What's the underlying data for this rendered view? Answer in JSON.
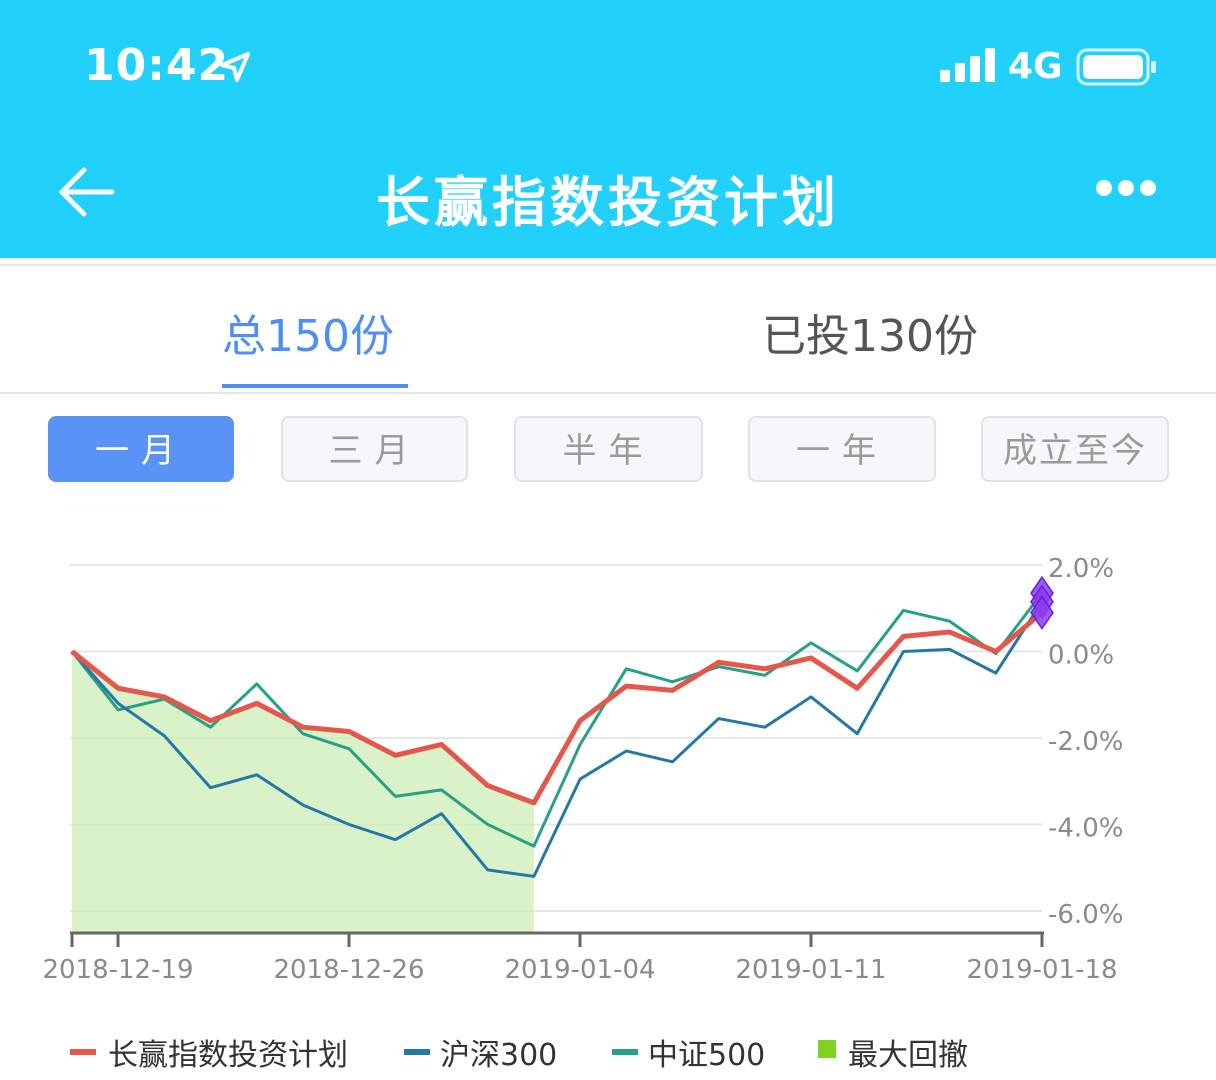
{
  "status_bar": {
    "time": "10:42",
    "network": "4G"
  },
  "nav": {
    "title": "长赢指数投资计划"
  },
  "tabs": [
    {
      "label": "总150份",
      "active": true
    },
    {
      "label": "已投130份",
      "active": false
    }
  ],
  "range_buttons": [
    {
      "label": "一月",
      "active": true
    },
    {
      "label": "三月",
      "active": false
    },
    {
      "label": "半年",
      "active": false
    },
    {
      "label": "一年",
      "active": false
    },
    {
      "label": "成立至今",
      "active": false
    }
  ],
  "colors": {
    "header_bg": "#21d0fb",
    "accent": "#4f8ff2",
    "plan_line": "#e5574a",
    "hs300_line": "#2478a8",
    "zz500_line": "#26a087",
    "drawdown_fill": "#cdeeb4",
    "drawdown_legend": "#7ed321",
    "marker": "#8b3cf0"
  },
  "chart_data": {
    "type": "line",
    "x_ticks": [
      "2018-12-19",
      "2018-12-26",
      "2019-01-04",
      "2019-01-11",
      "2019-01-18"
    ],
    "y_ticks": [
      "2.0%",
      "0.0%",
      "-2.0%",
      "-4.0%",
      "-6.0%"
    ],
    "ylim": [
      -6.5,
      2.0
    ],
    "series": [
      {
        "name": "长赢指数投资计划",
        "color": "#e5574a",
        "values": [
          0.0,
          -0.85,
          -1.05,
          -1.6,
          -1.2,
          -1.75,
          -1.85,
          -2.4,
          -2.15,
          -3.1,
          -3.5,
          -1.6,
          -0.8,
          -0.9,
          -0.25,
          -0.4,
          -0.15,
          -0.85,
          0.35,
          0.45,
          0.0,
          0.9
        ]
      },
      {
        "name": "沪深300",
        "color": "#2478a8",
        "values": [
          0.0,
          -1.2,
          -1.95,
          -3.15,
          -2.85,
          -3.55,
          -4.0,
          -4.35,
          -3.75,
          -5.05,
          -5.2,
          -2.95,
          -2.3,
          -2.55,
          -1.55,
          -1.75,
          -1.05,
          -1.9,
          0.0,
          0.05,
          -0.5,
          1.15
        ]
      },
      {
        "name": "中证500",
        "color": "#26a087",
        "values": [
          0.0,
          -1.35,
          -1.1,
          -1.75,
          -0.75,
          -1.9,
          -2.25,
          -3.35,
          -3.2,
          -4.0,
          -4.5,
          -2.15,
          -0.4,
          -0.7,
          -0.35,
          -0.55,
          0.2,
          -0.45,
          0.95,
          0.7,
          -0.05,
          1.35
        ]
      }
    ],
    "max_drawdown": {
      "name": "最大回撤",
      "from_index": 0,
      "to_index": 10
    }
  },
  "legend": [
    {
      "label": "长赢指数投资计划",
      "color": "#e5574a"
    },
    {
      "label": "沪深300",
      "color": "#2478a8"
    },
    {
      "label": "中证500",
      "color": "#26a087"
    },
    {
      "label": "最大回撤",
      "color": "#7ed321"
    }
  ]
}
